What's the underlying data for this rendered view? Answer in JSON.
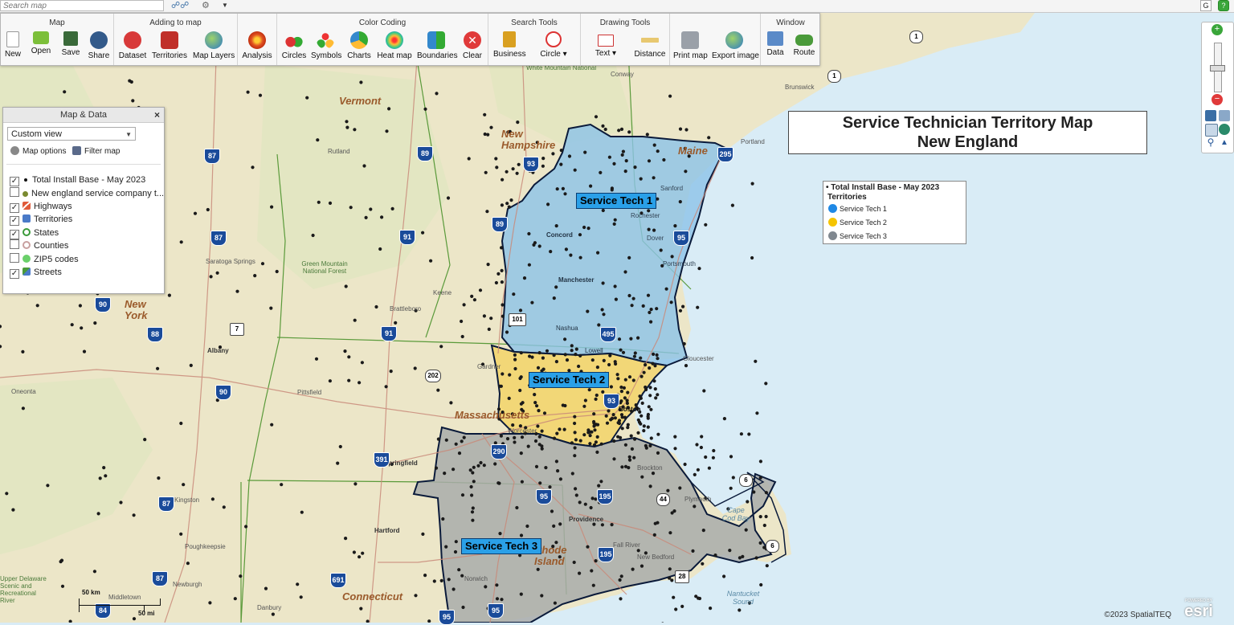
{
  "search": {
    "placeholder": "Search map"
  },
  "ribbon": {
    "groups": [
      {
        "title": "Map",
        "buttons": [
          "New",
          "Open",
          "Save",
          "Share"
        ]
      },
      {
        "title": "Adding to map",
        "buttons": [
          "Dataset",
          "Territories",
          "Map Layers"
        ]
      },
      {
        "title": "",
        "buttons": [
          "Analysis"
        ]
      },
      {
        "title": "Color Coding",
        "buttons": [
          "Circles",
          "Symbols",
          "Charts",
          "Heat map",
          "Boundaries",
          "Clear"
        ]
      },
      {
        "title": "Search Tools",
        "buttons": [
          "Business",
          "Circle ▾"
        ]
      },
      {
        "title": "Drawing Tools",
        "buttons": [
          "Text ▾",
          "Distance"
        ]
      },
      {
        "title": "",
        "buttons": [
          "Print map",
          "Export image"
        ]
      },
      {
        "title": "Window",
        "buttons": [
          "Data",
          "Route"
        ]
      }
    ]
  },
  "panel": {
    "title": "Map & Data",
    "close": "×",
    "view": "Custom view",
    "map_options": "Map options",
    "filter_map": "Filter map",
    "layers": [
      {
        "label": "Total Install Base - May 2023",
        "checked": true
      },
      {
        "label": "New england service company t...",
        "checked": false
      },
      {
        "label": "Highways",
        "checked": true
      },
      {
        "label": "Territories",
        "checked": true
      },
      {
        "label": "States",
        "checked": true
      },
      {
        "label": "Counties",
        "checked": false
      },
      {
        "label": "ZIP5 codes",
        "checked": false
      },
      {
        "label": "Streets",
        "checked": true
      }
    ]
  },
  "title": {
    "line1": "Service Technician Territory Map",
    "line2": "New England"
  },
  "legend": {
    "heading": "Total Install Base - May 2023",
    "subheading": "Territories",
    "items": [
      {
        "label": "Service Tech 1",
        "color": "#1e88e5"
      },
      {
        "label": "Service Tech 2",
        "color": "#f5c400"
      },
      {
        "label": "Service Tech 3",
        "color": "#808890"
      }
    ]
  },
  "territories": [
    {
      "label": "Service Tech 1",
      "color": "#8cc3e8"
    },
    {
      "label": "Service Tech 2",
      "color": "#f3d469"
    },
    {
      "label": "Service Tech 3",
      "color": "#a9acaa"
    }
  ],
  "places": {
    "states": [
      "Vermont",
      "New Hampshire",
      "Maine",
      "Massachusetts",
      "New York",
      "Connecticut",
      "Rhode Island"
    ],
    "cities": [
      "Rutland",
      "Concord",
      "Manchester",
      "Nashua",
      "Lowell",
      "Keene",
      "Brattleboro",
      "Pittsfield",
      "Springfield",
      "Worcester",
      "Boston",
      "Providence",
      "Fall River",
      "New Bedford",
      "Brockton",
      "Hartford",
      "Norwich",
      "Albany",
      "Kingston",
      "Poughkeepsie",
      "Newburgh",
      "Middletown",
      "Danbury",
      "Saratoga Springs",
      "Oneonta",
      "Portland",
      "Brunswick",
      "Sanford",
      "Rochester",
      "Dover",
      "Portsmouth",
      "Gloucester",
      "Plymouth",
      "Gardner",
      "Conway"
    ],
    "forests": [
      "Green Mountain National Forest",
      "White Mountain National Forest"
    ],
    "water": [
      "Cape Cod Bay",
      "Nantucket Sound"
    ],
    "park": "Upper Delaware Scenic and Recreational River"
  },
  "scale": {
    "km": "50 km",
    "mi": "50 mi"
  },
  "attribution": {
    "copyright": "©2023 SpatialTEQ",
    "brand": "esri",
    "powered": "POWERED BY"
  },
  "shields": [
    "87",
    "89",
    "93",
    "295",
    "87",
    "91",
    "89",
    "95",
    "90",
    "88",
    "91",
    "495",
    "90",
    "93",
    "391",
    "290",
    "87",
    "195",
    "95",
    "195",
    "84",
    "95",
    "95",
    "691",
    "87",
    "1",
    "1",
    "101",
    "202",
    "6",
    "6",
    "44",
    "28",
    "7"
  ],
  "colors": {
    "land": "#ece6c8",
    "water": "#d9ecf6",
    "tech1": "#8cc3e8",
    "tech2": "#f3d469",
    "tech3": "#a9acaa"
  }
}
